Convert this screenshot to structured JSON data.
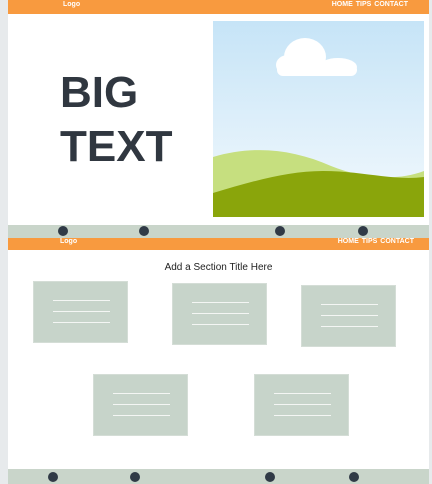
{
  "header": {
    "logo": "Logo",
    "nav": [
      "HOME",
      "TIPS",
      "CONTACT"
    ]
  },
  "hero": {
    "big_text_line1": "BIG",
    "big_text_line2": "TEXT"
  },
  "section": {
    "title": "Add a Section Title Here"
  },
  "colors": {
    "nav_bar": "#f89a3f",
    "dot_strip": "#c9d5ca",
    "dot": "#303a46",
    "card": "#c7d4ca",
    "big_text": "#303740"
  },
  "icons": [
    "landscape-image-icon",
    "cloud-icon",
    "hill-icon",
    "pagination-dot"
  ]
}
